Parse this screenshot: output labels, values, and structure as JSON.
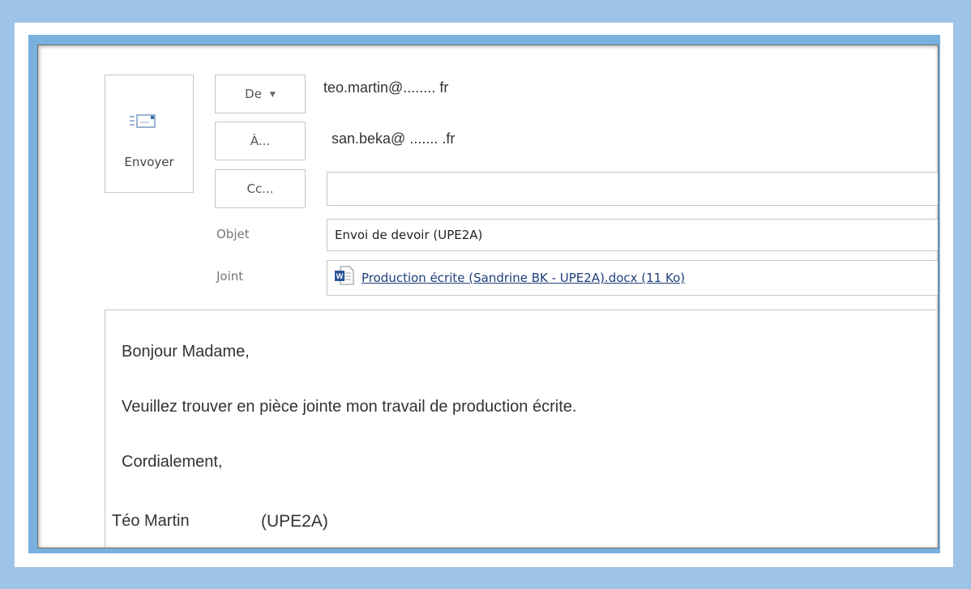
{
  "header": {
    "send_label": "Envoyer",
    "from_label": "De",
    "to_label": "À...",
    "cc_label": "Cc...",
    "from_address": "teo.martin@........   fr",
    "to_address": "san.beka@ .......  .fr",
    "cc_value": ""
  },
  "subject": {
    "label": "Objet",
    "value": "Envoi de devoir (UPE2A)"
  },
  "attachment": {
    "label": "Joint",
    "file": "Production écrite (Sandrine BK - UPE2A).docx (11 Ko)"
  },
  "body": {
    "greeting": "Bonjour Madame,",
    "message": "Veuillez trouver en pièce jointe mon travail de production écrite.",
    "closing": "Cordialement,",
    "signature_name": "Téo Martin",
    "signature_class": "(UPE2A)"
  },
  "icons": {
    "send": "envelope-send-icon",
    "attachment": "word-document-icon",
    "dropdown": "chevron-down-icon"
  }
}
